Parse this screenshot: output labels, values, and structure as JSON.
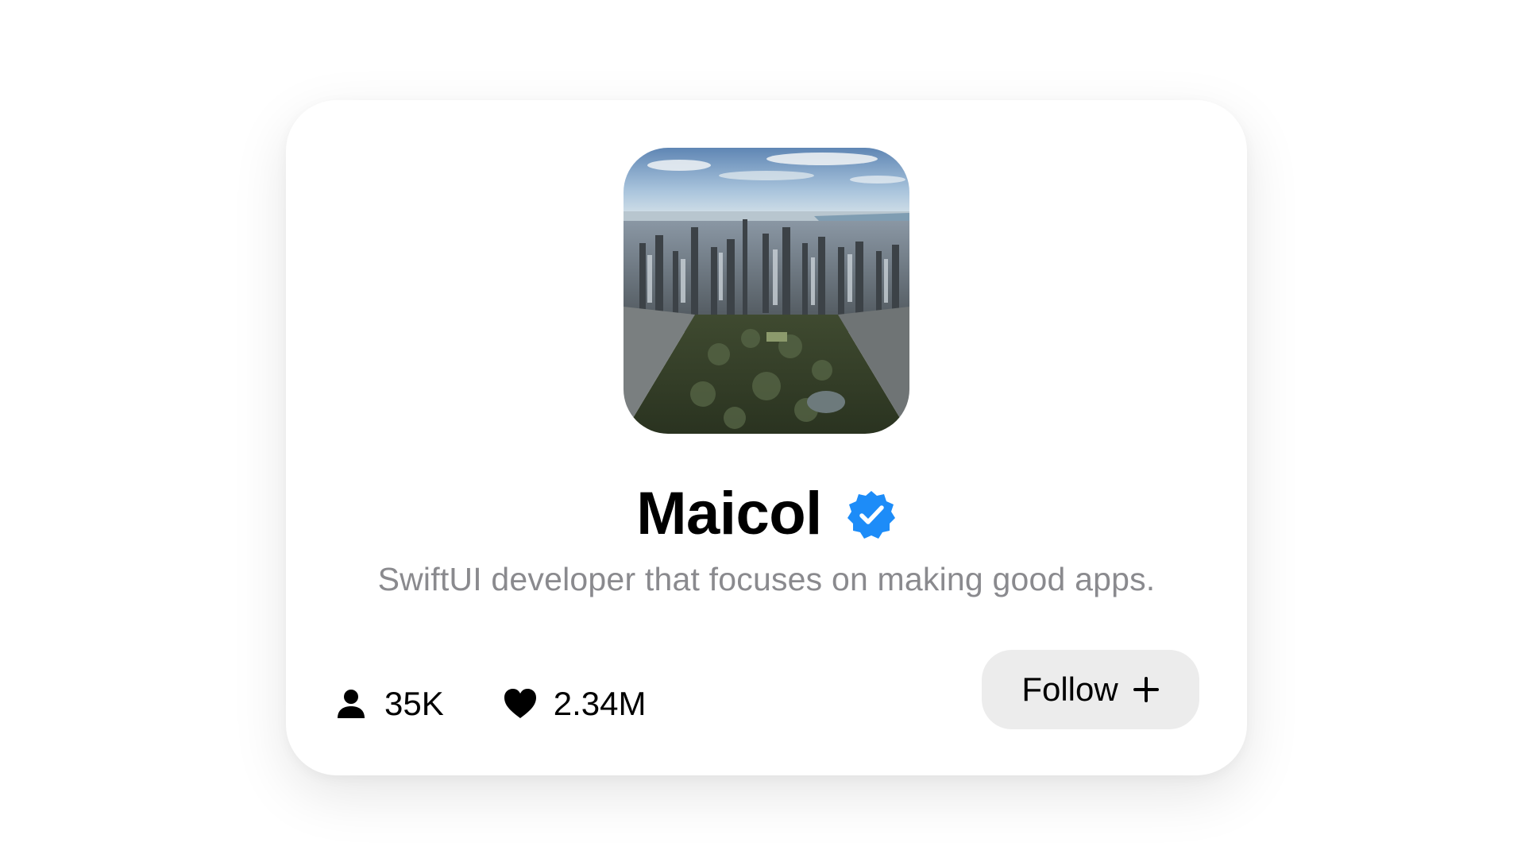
{
  "profile": {
    "name": "Maicol",
    "bio": "SwiftUI developer that focuses on making good apps.",
    "verified": true,
    "photo_subject": "aerial city skyline with park"
  },
  "stats": {
    "followers": "35K",
    "likes": "2.34M"
  },
  "actions": {
    "follow_label": "Follow"
  },
  "icons": {
    "verified": "verified-badge-icon",
    "followers": "person-icon",
    "likes": "heart-icon",
    "follow": "plus-icon"
  },
  "colors": {
    "verified_badge": "#1d8cf8",
    "bio_text": "#8a8a8e",
    "follow_button_bg": "#ececec"
  }
}
